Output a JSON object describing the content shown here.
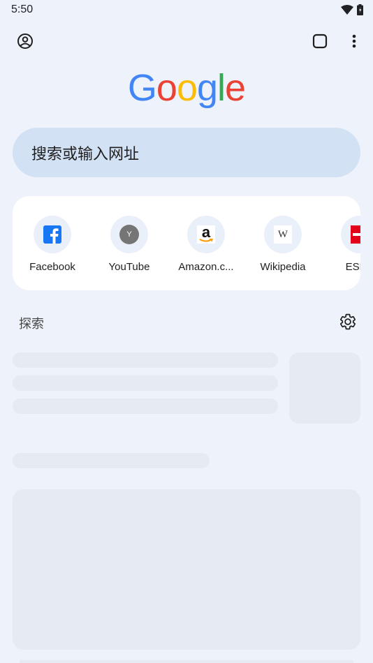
{
  "status_bar": {
    "time": "5:50"
  },
  "logo": {
    "letters": [
      "G",
      "o",
      "o",
      "g",
      "l",
      "e"
    ],
    "colors": [
      "#4285F4",
      "#EA4335",
      "#FBBC05",
      "#4285F4",
      "#34A853",
      "#EA4335"
    ]
  },
  "search": {
    "placeholder": "搜索或输入网址"
  },
  "shortcuts": [
    {
      "label": "Facebook",
      "icon": "facebook-icon"
    },
    {
      "label": "YouTube",
      "icon": "youtube-letter-icon",
      "glyph": "Y"
    },
    {
      "label": "Amazon.c...",
      "icon": "amazon-icon",
      "glyph": "a"
    },
    {
      "label": "Wikipedia",
      "icon": "wikipedia-icon",
      "glyph": "W"
    },
    {
      "label": "ESPN",
      "icon": "espn-icon"
    }
  ],
  "explore": {
    "label": "探索"
  },
  "colors": {
    "background": "#eef2fb",
    "search_bg": "#d3e1f5",
    "skeleton": "#e6eaf3"
  }
}
